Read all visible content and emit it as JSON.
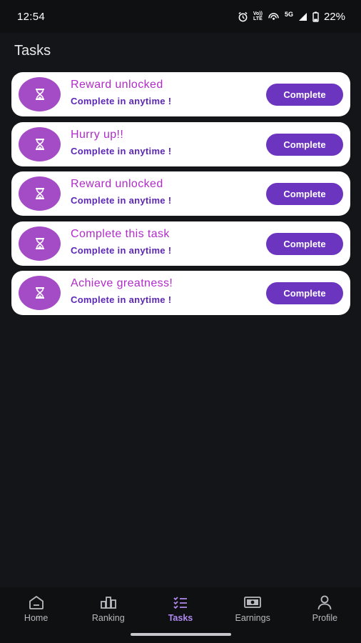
{
  "status_bar": {
    "time": "12:54",
    "volte_top": "Vo))",
    "volte_bottom": "LTE",
    "network": "5G",
    "battery": "22%"
  },
  "page": {
    "title": "Tasks"
  },
  "tasks": [
    {
      "title": "Reward unlocked",
      "subtitle": "Complete in anytime !",
      "button": "Complete",
      "icon": "hourglass-icon"
    },
    {
      "title": "Hurry up!!",
      "subtitle": "Complete in anytime !",
      "button": "Complete",
      "icon": "hourglass-icon"
    },
    {
      "title": "Reward unlocked",
      "subtitle": "Complete in anytime !",
      "button": "Complete",
      "icon": "hourglass-icon"
    },
    {
      "title": "Complete this task",
      "subtitle": "Complete in anytime !",
      "button": "Complete",
      "icon": "hourglass-icon"
    },
    {
      "title": "Achieve greatness!",
      "subtitle": "Complete in anytime !",
      "button": "Complete",
      "icon": "hourglass-icon"
    }
  ],
  "nav": {
    "items": [
      {
        "label": "Home",
        "icon": "home-icon",
        "active": false
      },
      {
        "label": "Ranking",
        "icon": "ranking-icon",
        "active": false
      },
      {
        "label": "Tasks",
        "icon": "tasks-icon",
        "active": true
      },
      {
        "label": "Earnings",
        "icon": "earnings-icon",
        "active": false
      },
      {
        "label": "Profile",
        "icon": "profile-icon",
        "active": false
      }
    ]
  },
  "colors": {
    "background": "#141518",
    "card": "#ffffff",
    "icon_circle": "#a44bc6",
    "title_text": "#b02bc8",
    "subtitle_text": "#5b27b4",
    "button": "#6c35c0",
    "active_nav": "#b089f0"
  }
}
